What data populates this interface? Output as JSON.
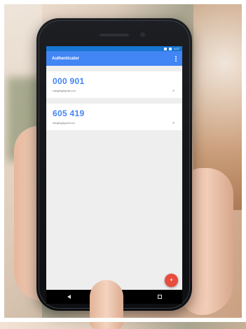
{
  "status_bar": {
    "time": "4:27",
    "icons": [
      "wifi-icon",
      "battery-icon"
    ]
  },
  "app_bar": {
    "title": "Authenticator",
    "menu_icon": "overflow-menu-icon"
  },
  "accounts": [
    {
      "code": "000 901",
      "email": "sultagfbg@gmail.com"
    },
    {
      "code": "605 419",
      "email": "bktogfbg@gmail.com"
    }
  ],
  "fab": {
    "label": "+"
  },
  "nav_bar": {
    "icons": [
      "back-icon",
      "home-icon",
      "recents-icon"
    ]
  },
  "colors": {
    "primary": "#4285f4",
    "status": "#1976d2",
    "fab": "#e74c3c"
  }
}
